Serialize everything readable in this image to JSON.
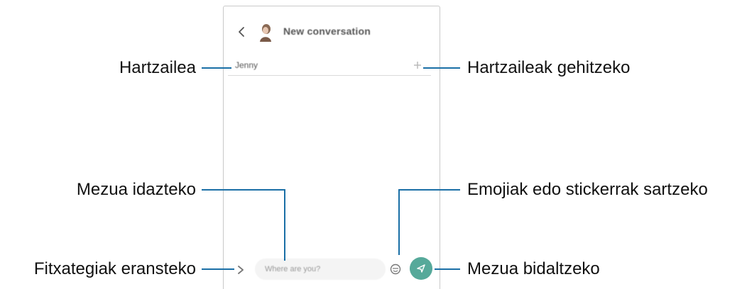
{
  "screen": {
    "title": "New conversation",
    "recipient": "Jenny",
    "message_placeholder": "Where are you?"
  },
  "callouts": {
    "recipient": "Hartzailea",
    "add_recipients": "Hartzaileak gehitzeko",
    "compose_message": "Mezua idazteko",
    "emoji_stickers": "Emojiak edo stickerrak sartzeko",
    "attach_files": "Fitxategiak eransteko",
    "send_message": "Mezua bidaltzeko"
  },
  "icons": {
    "back": "chevron-left-icon",
    "avatar": "contact-avatar",
    "add": "plus-icon",
    "attach": "chevron-right-icon",
    "emoji": "emoji-icon",
    "send": "send-icon"
  },
  "colors": {
    "callout_line": "#1a6fa6",
    "send_button": "#56a99a"
  }
}
